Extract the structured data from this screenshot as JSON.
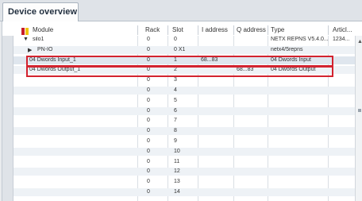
{
  "tab": {
    "label": "Device overview"
  },
  "columns": {
    "module": "Module",
    "rack": "Rack",
    "slot": "Slot",
    "iaddr": "I address",
    "qaddr": "Q address",
    "type": "Type",
    "article": "Articl..."
  },
  "rows": [
    {
      "expander": "▼",
      "module": "silo1",
      "rack": "0",
      "slot": "0",
      "i": "",
      "q": "",
      "type": "NETX REPNS V5.4.0...",
      "article": "1234..."
    },
    {
      "expander": "▶",
      "module": "PN-IO",
      "rack": "0",
      "slot": "0 X1",
      "i": "",
      "q": "",
      "type": "netx4/5repns",
      "article": ""
    },
    {
      "expander": "",
      "module": "04 Dwords Input_1",
      "rack": "0",
      "slot": "1",
      "i": "68...83",
      "q": "",
      "type": "04 Dwords Input",
      "article": ""
    },
    {
      "expander": "",
      "module": "04 Dwords Output_1",
      "rack": "0",
      "slot": "2",
      "i": "",
      "q": "68...83",
      "type": "04 Dwords Output",
      "article": ""
    },
    {
      "expander": "",
      "module": "",
      "rack": "0",
      "slot": "3",
      "i": "",
      "q": "",
      "type": "",
      "article": ""
    },
    {
      "expander": "",
      "module": "",
      "rack": "0",
      "slot": "4",
      "i": "",
      "q": "",
      "type": "",
      "article": ""
    },
    {
      "expander": "",
      "module": "",
      "rack": "0",
      "slot": "5",
      "i": "",
      "q": "",
      "type": "",
      "article": ""
    },
    {
      "expander": "",
      "module": "",
      "rack": "0",
      "slot": "6",
      "i": "",
      "q": "",
      "type": "",
      "article": ""
    },
    {
      "expander": "",
      "module": "",
      "rack": "0",
      "slot": "7",
      "i": "",
      "q": "",
      "type": "",
      "article": ""
    },
    {
      "expander": "",
      "module": "",
      "rack": "0",
      "slot": "8",
      "i": "",
      "q": "",
      "type": "",
      "article": ""
    },
    {
      "expander": "",
      "module": "",
      "rack": "0",
      "slot": "9",
      "i": "",
      "q": "",
      "type": "",
      "article": ""
    },
    {
      "expander": "",
      "module": "",
      "rack": "0",
      "slot": "10",
      "i": "",
      "q": "",
      "type": "",
      "article": ""
    },
    {
      "expander": "",
      "module": "",
      "rack": "0",
      "slot": "11",
      "i": "",
      "q": "",
      "type": "",
      "article": ""
    },
    {
      "expander": "",
      "module": "",
      "rack": "0",
      "slot": "12",
      "i": "",
      "q": "",
      "type": "",
      "article": ""
    },
    {
      "expander": "",
      "module": "",
      "rack": "0",
      "slot": "13",
      "i": "",
      "q": "",
      "type": "",
      "article": ""
    },
    {
      "expander": "",
      "module": "",
      "rack": "0",
      "slot": "14",
      "i": "",
      "q": "",
      "type": "",
      "article": ""
    }
  ],
  "highlighted_rows": [
    "04 Dwords Input_1",
    "04 Dwords Output_1"
  ],
  "icons": {
    "module_header": "module-icon",
    "scroll_up": "scroll-up-icon"
  },
  "colors": {
    "highlight": "#d3232f",
    "module_icon_a": "#c81e28",
    "module_icon_b": "#f1c40f"
  }
}
